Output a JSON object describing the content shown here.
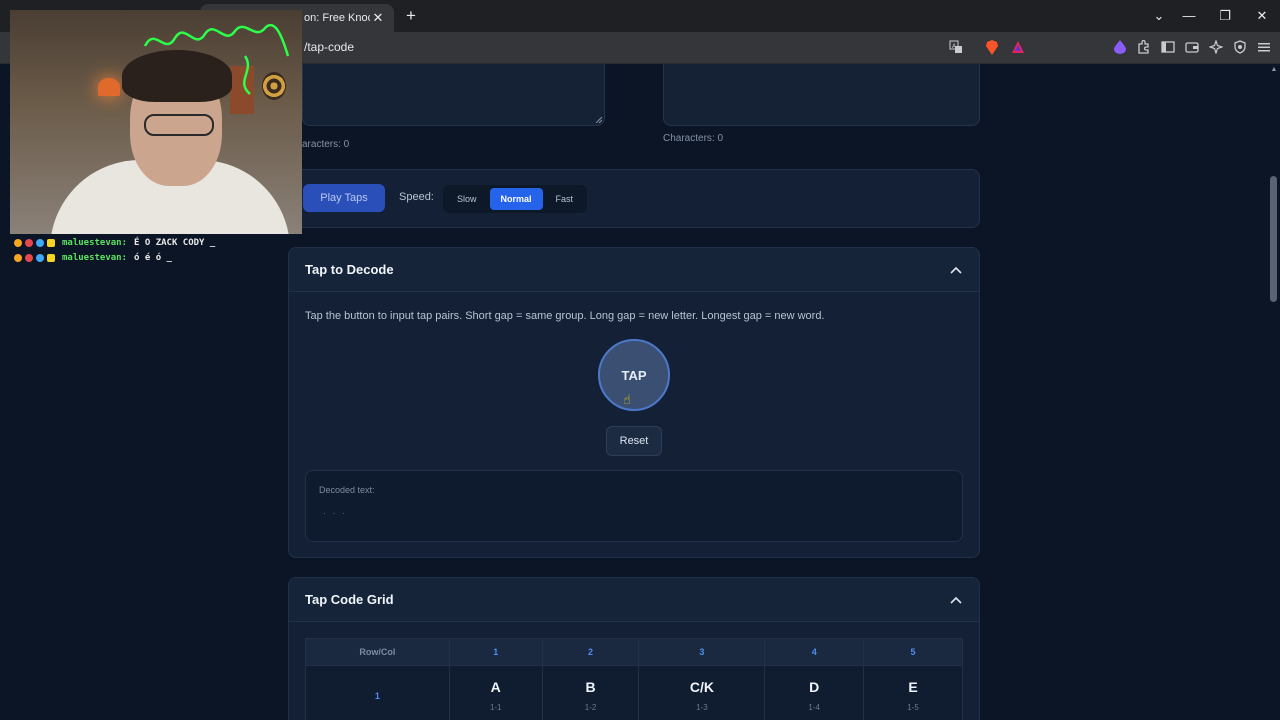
{
  "browser": {
    "tab_title": "on: Free Knock Co",
    "tab_close": "✕",
    "new_tab": "+",
    "url": "/tap-code",
    "window_controls": {
      "dropdown": "⌄",
      "minimize": "—",
      "restore": "❐",
      "close": "✕"
    },
    "toolbar_icons": [
      "translate-icon",
      "brave-shield-icon",
      "brave-rewards-icon",
      "leo-icon",
      "extensions-icon",
      "sidebar-icon",
      "wallet-icon",
      "ai-icon",
      "vpn-icon",
      "menu-icon"
    ]
  },
  "stream": {
    "chat": [
      {
        "user": "maluestevan:",
        "message": "É O ZACK CODY _"
      },
      {
        "user": "maluestevan:",
        "message": "ó é ó _"
      }
    ]
  },
  "encoder": {
    "left_char_count": "aracters: 0",
    "right_char_count": "Characters: 0",
    "play_label": "Play Taps",
    "speed_label": "Speed:",
    "speed_options": [
      "Slow",
      "Normal",
      "Fast"
    ],
    "speed_selected": "Normal"
  },
  "decoder": {
    "title": "Tap to Decode",
    "instructions": "Tap the button to input tap pairs. Short gap = same group. Long gap = new letter. Longest gap = new word.",
    "tap_label": "TAP",
    "reset_label": "Reset",
    "decoded_label": "Decoded text:",
    "decoded_value": "· · ·"
  },
  "grid": {
    "title": "Tap Code Grid",
    "corner_header": "Row/Col",
    "columns": [
      "1",
      "2",
      "3",
      "4",
      "5"
    ],
    "rows": [
      {
        "label": "1",
        "cells": [
          {
            "letter": "A",
            "code": "1-1"
          },
          {
            "letter": "B",
            "code": "1-2"
          },
          {
            "letter": "C/K",
            "code": "1-3"
          },
          {
            "letter": "D",
            "code": "1-4"
          },
          {
            "letter": "E",
            "code": "1-5"
          }
        ]
      }
    ]
  },
  "icons": {
    "chevron_up": "︿",
    "cursor": "☝"
  },
  "colors": {
    "accent": "#2563eb",
    "background": "#0c1526",
    "card": "#132035",
    "column_header": "#4d8ef0"
  }
}
